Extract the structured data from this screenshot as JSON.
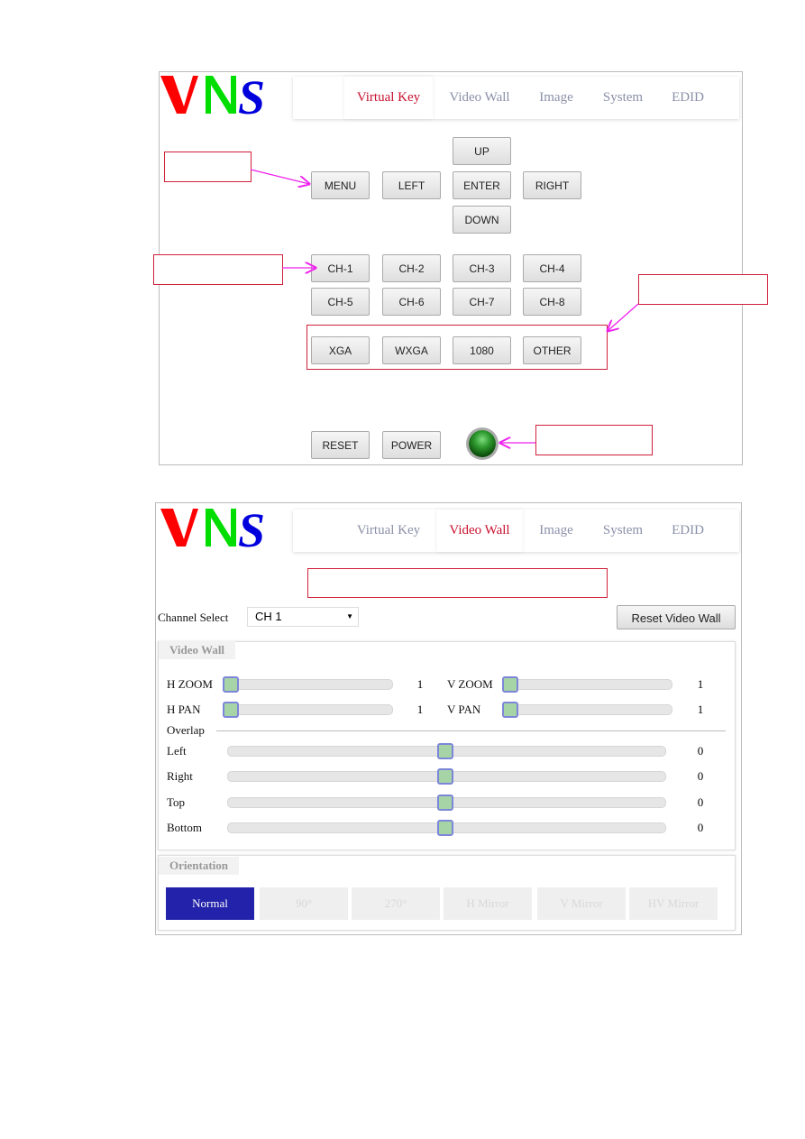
{
  "logo": {
    "text": "VNS",
    "colors": [
      "#ff0000",
      "#00dd00",
      "#0000dd"
    ]
  },
  "nav": {
    "tabs": [
      "Virtual Key",
      "Video Wall",
      "Image",
      "System",
      "EDID"
    ]
  },
  "virtual_key": {
    "active_tab": "Virtual Key",
    "buttons": {
      "up": "UP",
      "menu": "MENU",
      "left": "LEFT",
      "enter": "ENTER",
      "right": "RIGHT",
      "down": "DOWN"
    },
    "channels": [
      "CH-1",
      "CH-2",
      "CH-3",
      "CH-4",
      "CH-5",
      "CH-6",
      "CH-7",
      "CH-8"
    ],
    "resolutions": [
      "XGA",
      "WXGA",
      "1080",
      "OTHER"
    ],
    "reset": "RESET",
    "power": "POWER",
    "led_color": "#2f9a2f"
  },
  "video_wall": {
    "active_tab": "Video Wall",
    "channel_select_label": "Channel Select",
    "channel_value": "CH 1",
    "reset_button": "Reset Video Wall",
    "section_title": "Video Wall",
    "h_zoom": {
      "label": "H ZOOM",
      "value": "1"
    },
    "v_zoom": {
      "label": "V ZOOM",
      "value": "1"
    },
    "h_pan": {
      "label": "H PAN",
      "value": "1"
    },
    "v_pan": {
      "label": "V PAN",
      "value": "1"
    },
    "overlap_label": "Overlap",
    "overlap": [
      {
        "label": "Left",
        "value": "0"
      },
      {
        "label": "Right",
        "value": "0"
      },
      {
        "label": "Top",
        "value": "0"
      },
      {
        "label": "Bottom",
        "value": "0"
      }
    ],
    "orientation_title": "Orientation",
    "orientation_options": [
      "Normal",
      "90°",
      "270°",
      "H Mirror",
      "V Mirror",
      "HV Mirror"
    ],
    "orientation_selected": "Normal",
    "accent": "#2222aa"
  },
  "annotation_colors": {
    "callout_border": "#d0203a",
    "arrow": "#ee22ee"
  }
}
